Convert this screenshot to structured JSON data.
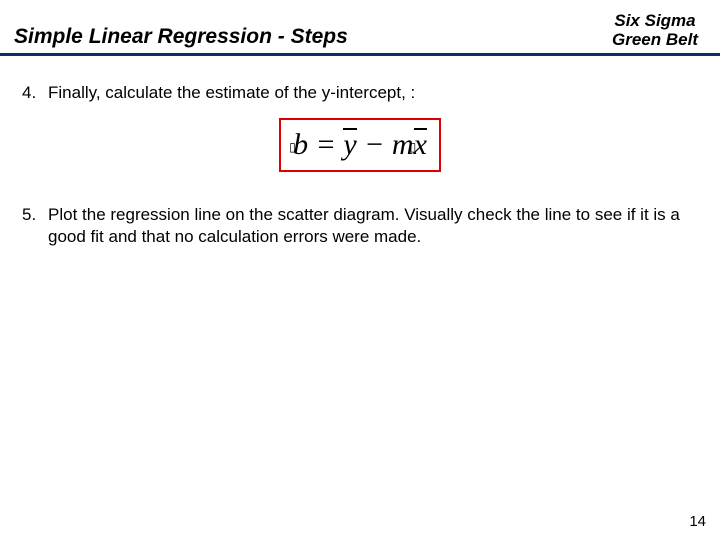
{
  "header": {
    "title": "Simple Linear Regression - Steps",
    "brand_line1": "Six Sigma",
    "brand_line2": "Green Belt"
  },
  "steps": {
    "s4_num": "4.",
    "s4_text": "Finally, calculate the estimate of the y-intercept, :",
    "s5_num": "5.",
    "s5_text": "Plot the regression line on the scatter diagram.  Visually check the line to see if it is a good fit and that no calculation errors were made."
  },
  "equation": {
    "b": "b",
    "eq": " = ",
    "ybar": "y",
    "minus": " − ",
    "m": "m",
    "xbar": "x"
  },
  "page_number": "14"
}
